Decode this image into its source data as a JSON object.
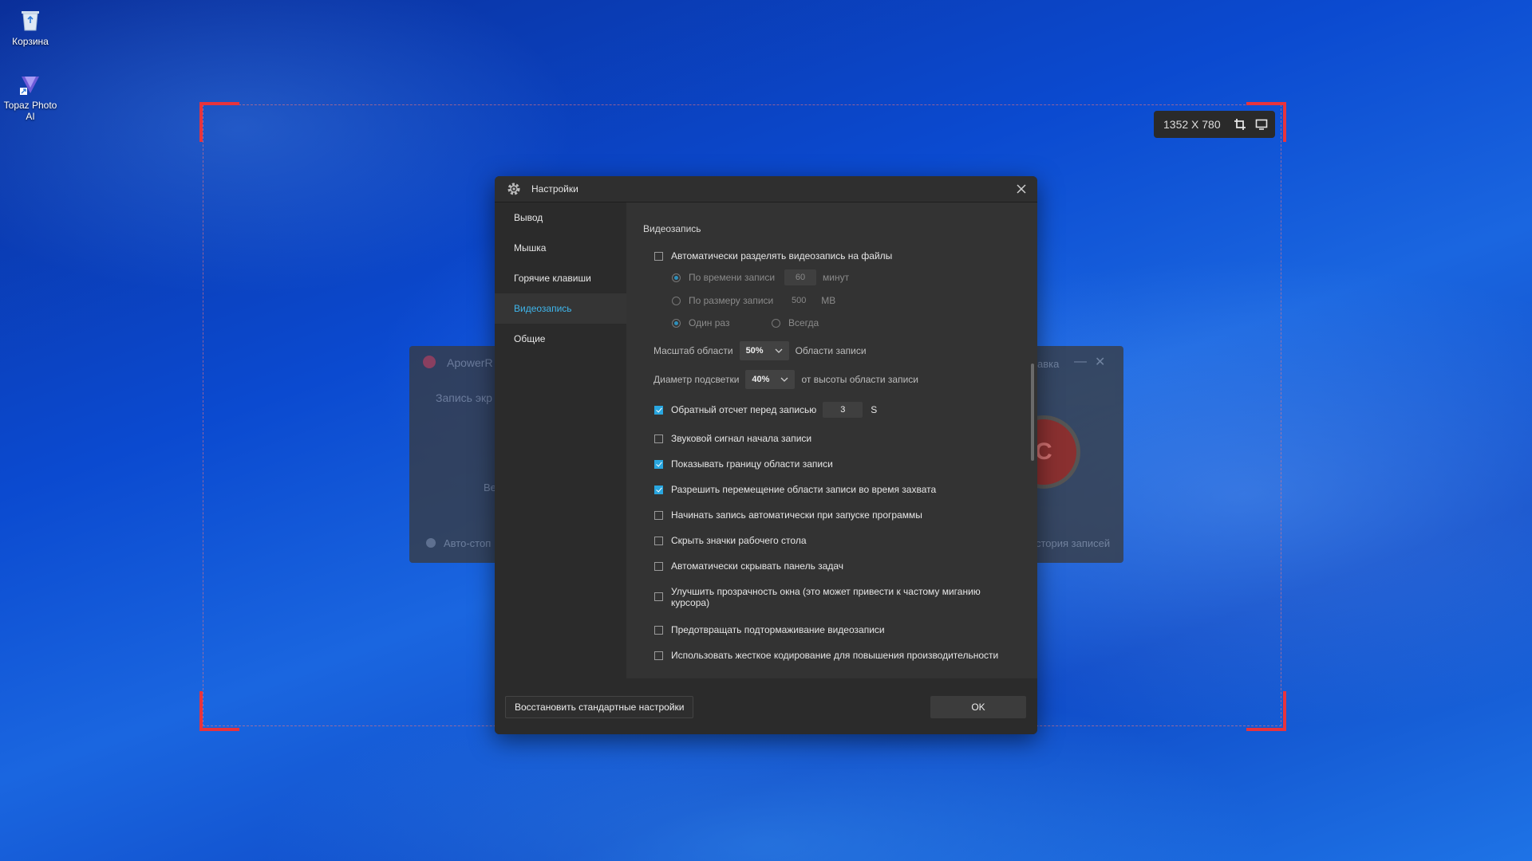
{
  "desktop": {
    "icons": [
      {
        "label": "Корзина",
        "icon": "recycle-bin-icon"
      },
      {
        "label": "Topaz Photo AI",
        "icon": "topaz-photo-ai-icon"
      }
    ]
  },
  "capture": {
    "size_text": "1352 X 780",
    "accent_color": "#e8333d"
  },
  "background_app": {
    "title": "ApowerR",
    "subtitle": "Запись экр",
    "middle_text": "Ве",
    "auto_stop": "Авто-стоп",
    "right_title": "авка",
    "history": "стория записей",
    "rec_letter": "C"
  },
  "dialog": {
    "title": "Настройки",
    "sidebar": [
      {
        "label": "Вывод"
      },
      {
        "label": "Мышка"
      },
      {
        "label": "Горячие клавиши"
      },
      {
        "label": "Видеозапись",
        "active": true
      },
      {
        "label": "Общие"
      }
    ],
    "section_title": "Видеозапись",
    "auto_split": {
      "label": "Автоматически разделять видеозапись на файлы",
      "checked": false
    },
    "by_time": {
      "label": "По времени записи",
      "value": "60",
      "unit": "минут",
      "selected": true
    },
    "by_size": {
      "label": "По размеру записи",
      "value": "500",
      "unit": "MB",
      "selected": false
    },
    "once": {
      "label": "Один раз",
      "selected": true
    },
    "always": {
      "label": "Всегда",
      "selected": false
    },
    "area_scale": {
      "label": "Масштаб области",
      "value": "50%",
      "suffix": "Области записи"
    },
    "highlight_diameter": {
      "label": "Диаметр подсветки",
      "value": "40%",
      "suffix": "от высоты области записи"
    },
    "countdown": {
      "label": "Обратный отсчет перед записью",
      "value": "3",
      "unit": "S",
      "checked": true
    },
    "options": [
      {
        "label": "Звуковой сигнал начала записи",
        "checked": false
      },
      {
        "label": "Показывать границу области записи",
        "checked": true
      },
      {
        "label": "Разрешить перемещение области записи во время захвата",
        "checked": true
      },
      {
        "label": "Начинать запись автоматически при запуске программы",
        "checked": false
      },
      {
        "label": "Скрыть значки рабочего стола",
        "checked": false
      },
      {
        "label": "Автоматически скрывать панель задач",
        "checked": false
      },
      {
        "label": "Улучшить прозрачность окна (это может привести к частому миганию курсора)",
        "checked": false
      },
      {
        "label": "Предотвращать подтормаживание видеозаписи",
        "checked": false
      },
      {
        "label": "Использовать жесткое кодирование для повышения производительности",
        "checked": false
      }
    ],
    "restore_button": "Восстановить стандартные настройки",
    "ok_button": "OK",
    "active_color": "#3fb6ec",
    "check_color": "#29a6df"
  }
}
